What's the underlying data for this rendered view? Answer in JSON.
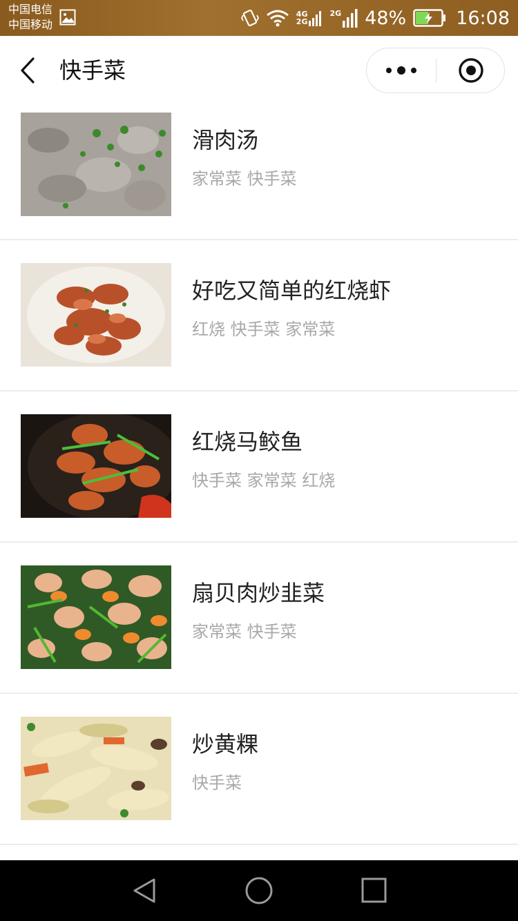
{
  "status_bar": {
    "carrier_1": "中国电信",
    "carrier_2": "中国移动",
    "network_1": "4G",
    "network_1b": "2G",
    "network_2": "2G",
    "battery_percent": "48%",
    "time": "16:08",
    "battery_level": 0.48,
    "icons": [
      "image-icon",
      "vibrate-icon",
      "wifi-icon",
      "signal-icon",
      "battery-charging-icon"
    ]
  },
  "nav": {
    "title": "快手菜",
    "icons": [
      "back-arrow-icon",
      "more-dots-icon",
      "close-target-icon"
    ]
  },
  "recipes": [
    {
      "name": "滑肉汤",
      "tags": "家常菜 快手菜"
    },
    {
      "name": "好吃又简单的红烧虾",
      "tags": "红烧 快手菜 家常菜"
    },
    {
      "name": "红烧马鲛鱼",
      "tags": "快手菜 家常菜 红烧"
    },
    {
      "name": "扇贝肉炒韭菜",
      "tags": "家常菜 快手菜"
    },
    {
      "name": "炒黄粿",
      "tags": "快手菜"
    }
  ],
  "system_nav": {
    "icons": [
      "back-triangle-icon",
      "home-circle-icon",
      "recents-square-icon"
    ]
  },
  "colors": {
    "status_bar": "#8a5a1e",
    "title_text": "#111111",
    "tag_text": "#a8a8a8",
    "divider": "#ececec",
    "system_nav": "#000000"
  }
}
